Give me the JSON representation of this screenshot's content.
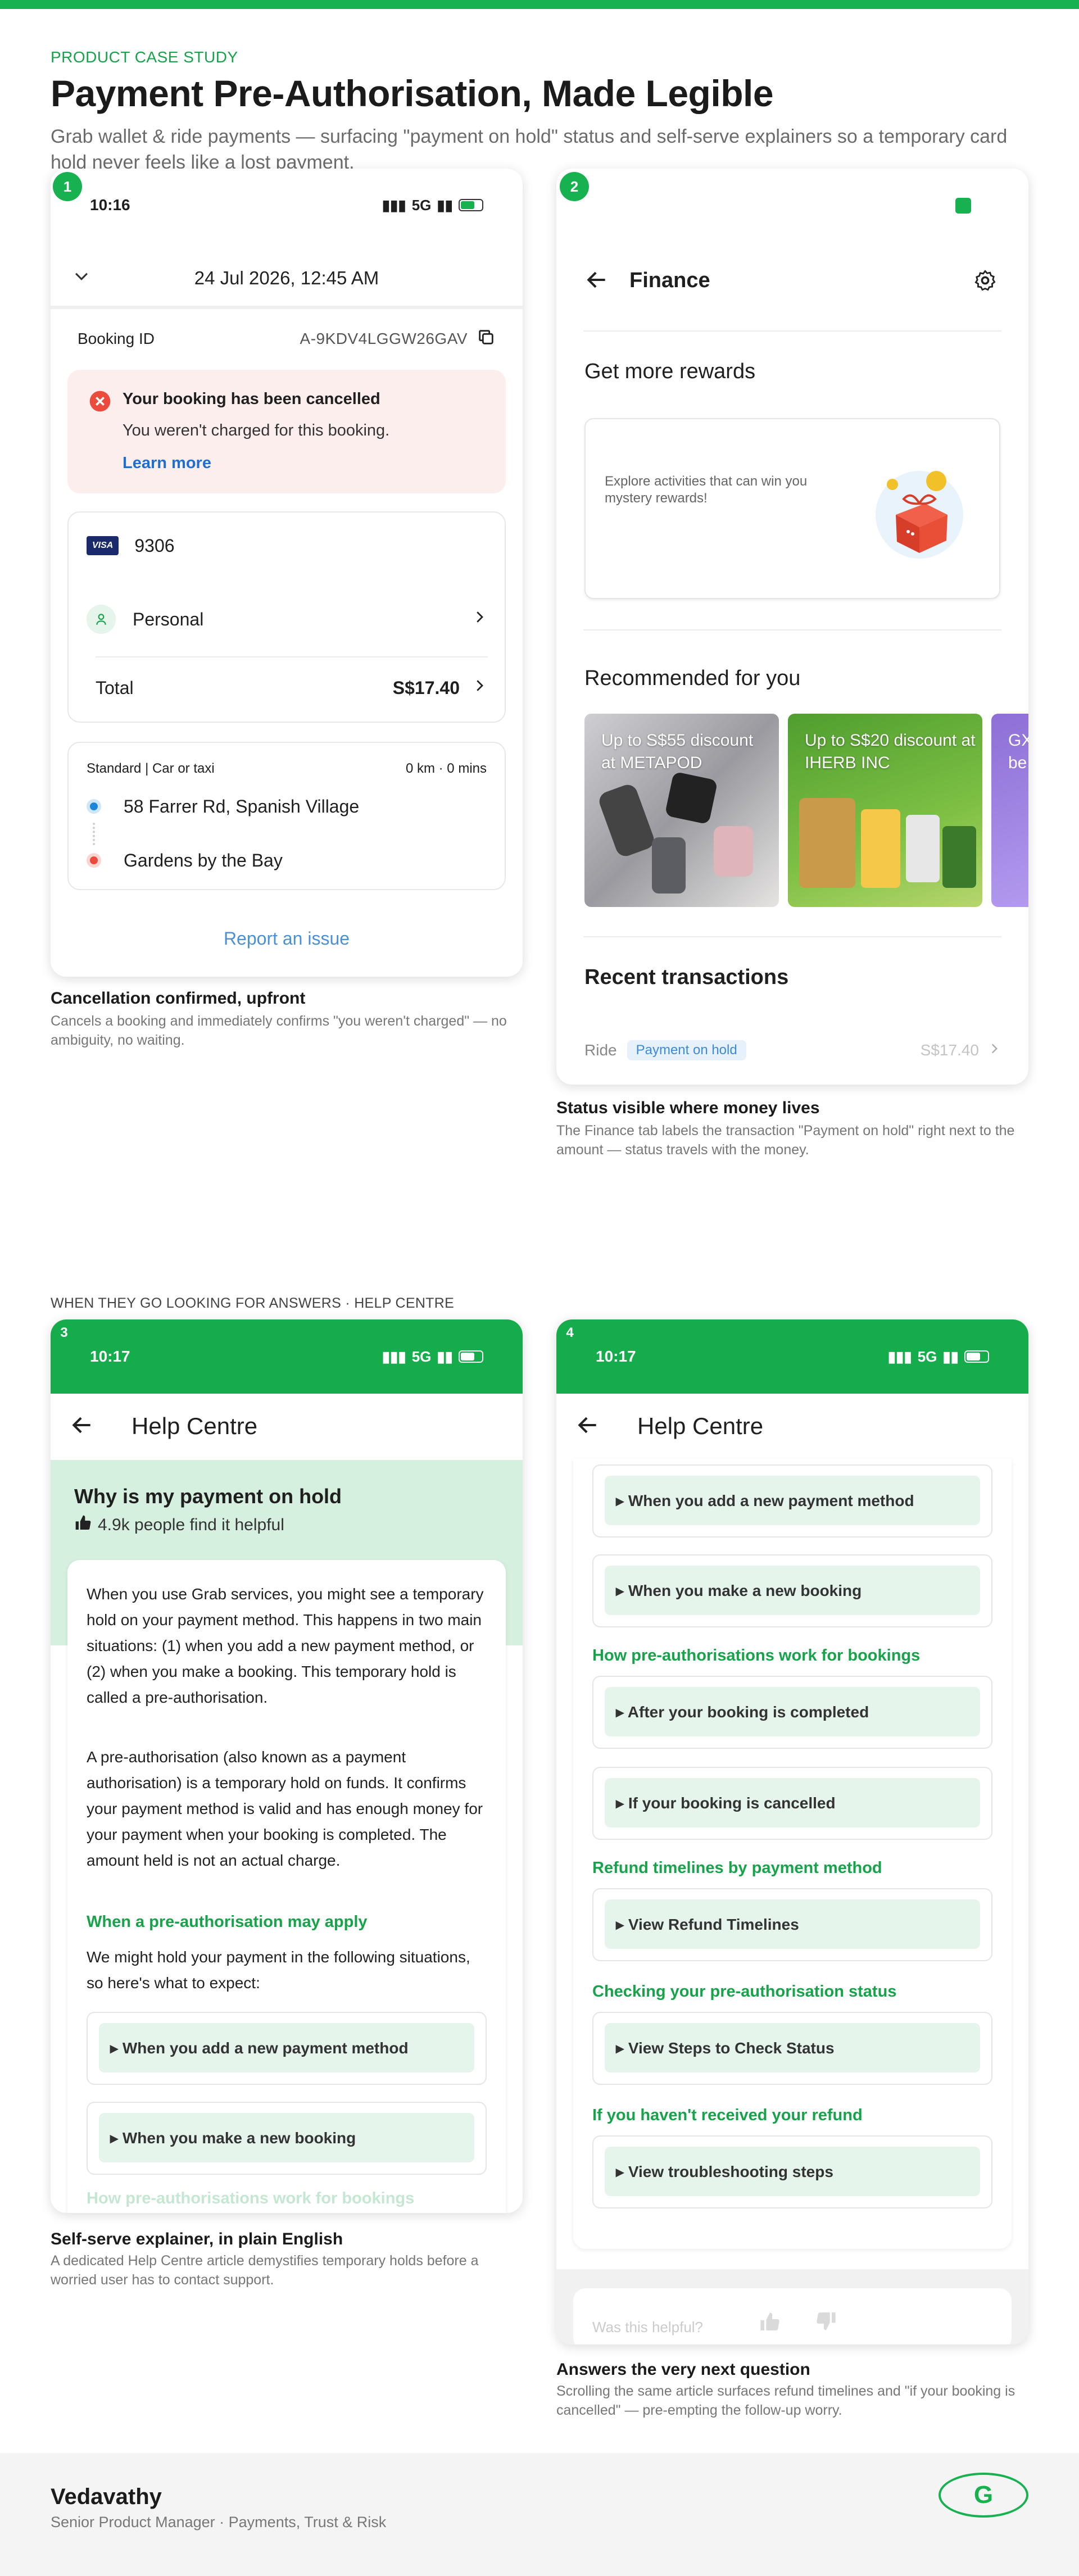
{
  "header": {
    "eyebrow": "PRODUCT CASE STUDY",
    "title": "Payment Pre-Authorisation, Made Legible",
    "subtitle": "Grab wallet & ride payments — surfacing \"payment on hold\" status and self-serve explainers so a temporary card hold never feels like a lost payment."
  },
  "colors": {
    "brand": "#17b150",
    "cancel_bg": "#fdeeee",
    "cancel_icon": "#ea4b3c",
    "link": "#1d6fd1",
    "hold_badge": "#e6f1fc"
  },
  "screen1": {
    "badge": "1",
    "time": "10:16",
    "network": "5G",
    "datetime": "24 Jul 2026, 12:45 AM",
    "booking_id_label": "Booking ID",
    "booking_id": "A-9KDV4LGGW26GAV",
    "cancel_title": "Your booking has been cancelled",
    "cancel_body": "You weren't charged for this booking.",
    "learn_more": "Learn more",
    "card_brand": "VISA",
    "card_last4": "9306",
    "profile": "Personal",
    "total_label": "Total",
    "total_value": "S$17.40",
    "ride_type": "Standard | Car or taxi",
    "ride_meta": "0 km · 0 mins",
    "pickup": "58 Farrer Rd, Spanish Village",
    "dropoff": "Gardens by the Bay",
    "report": "Report an issue",
    "caption": "Cancellation confirmed, upfront",
    "caption_sub": "Cancels a booking and immediately confirms \"you weren't charged\" — no ambiguity, no waiting."
  },
  "screen2": {
    "badge": "2",
    "title": "Finance",
    "rewards_heading": "Get more rewards",
    "rewards_text": "Explore activities that can win you mystery rewards!",
    "recommended_heading": "Recommended for you",
    "promos": [
      {
        "text": "Up to S$55 discount at METAPOD"
      },
      {
        "text": "Up to S$20 discount at IHERB INC"
      },
      {
        "text": "GX be"
      }
    ],
    "recent_heading": "Recent transactions",
    "txn_label": "Ride",
    "txn_status": "Payment on hold",
    "txn_amount": "S$17.40",
    "caption": "Status visible where money lives",
    "caption_sub": "The Finance tab labels the transaction \"Payment on hold\" right next to the amount — status travels with the money."
  },
  "section_label": "WHEN THEY GO LOOKING FOR ANSWERS · HELP CENTRE",
  "screen3": {
    "badge": "3",
    "time": "10:17",
    "network": "5G",
    "title": "Help Centre",
    "article_title": "Why is my payment on hold",
    "helpful": "4.9k people find it helpful",
    "para1": "When you use Grab services, you might see a temporary hold on your payment method. This happens in two main situations: (1) when you add a new payment method, or (2) when you make a booking. This temporary hold is called a pre-authorisation.",
    "para2": "A pre-authorisation (also known as a payment authorisation) is a temporary hold on funds. It confirms your payment method is valid and has enough money for your payment when your booking is completed. The amount held is not an actual charge.",
    "section_title": "When a pre-authorisation may apply",
    "section_body": "We might hold your payment in the following situations, so here's what to expect:",
    "acc1": "▸ When you add a new payment method",
    "acc2": "▸ When you make a new booking",
    "faded": "How pre-authorisations work for bookings",
    "caption": "Self-serve explainer, in plain English",
    "caption_sub": "A dedicated Help Centre article demystifies temporary holds before a worried user has to contact support."
  },
  "screen4": {
    "badge": "4",
    "time": "10:17",
    "network": "5G",
    "title": "Help Centre",
    "acc_a": "▸ When you add a new payment method",
    "acc_b": "▸ When you make a new booking",
    "head1": "How pre-authorisations work for bookings",
    "acc_c": "▸ After your booking is completed",
    "acc_d": "▸ If your booking is cancelled",
    "head2": "Refund timelines by payment method",
    "acc_e": "▸ View Refund Timelines",
    "head3": "Checking your pre-authorisation status",
    "acc_f": "▸ View Steps to Check Status",
    "head4": "If you haven't received your refund",
    "acc_g": "▸ View troubleshooting steps",
    "helpful_q": "Was this helpful?",
    "caption": "Answers the very next question",
    "caption_sub": "Scrolling the same article surfaces refund timelines and \"if your booking is cancelled\" — pre-empting the follow-up worry."
  },
  "footer": {
    "name": "Vedavathy",
    "role": "Senior Product Manager · Payments, Trust & Risk",
    "logo_letter": "G"
  }
}
